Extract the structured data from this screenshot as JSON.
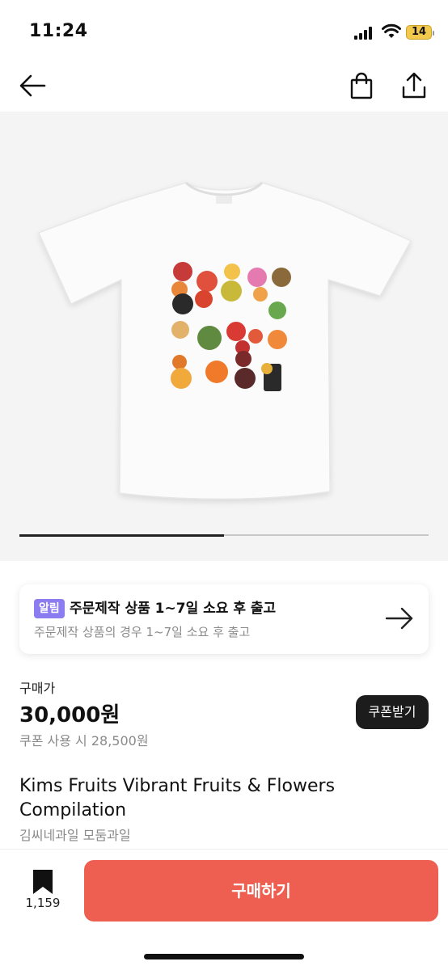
{
  "status_bar": {
    "time": "11:24",
    "battery": "14"
  },
  "gallery": {
    "progress": 0.5
  },
  "notice": {
    "badge": "알림",
    "title": "주문제작 상품 1~7일 소요 후 출고",
    "subtitle": "주문제작 상품의 경우  1~7일 소요 후 출고"
  },
  "price": {
    "label": "구매가",
    "value": "30,000원",
    "coupon_text": "쿠폰 사용 시 28,500원",
    "coupon_button": "쿠폰받기"
  },
  "product": {
    "title": "Kims Fruits Vibrant Fruits & Flowers Compilation",
    "shop": "김씨네과일 모둠과일"
  },
  "bottom": {
    "bookmark_count": "1,159",
    "buy_button": "구매하기"
  },
  "colors": {
    "accent": "#ee5f52",
    "badge": "#8b7cf0",
    "battery": "#f2c94c"
  }
}
